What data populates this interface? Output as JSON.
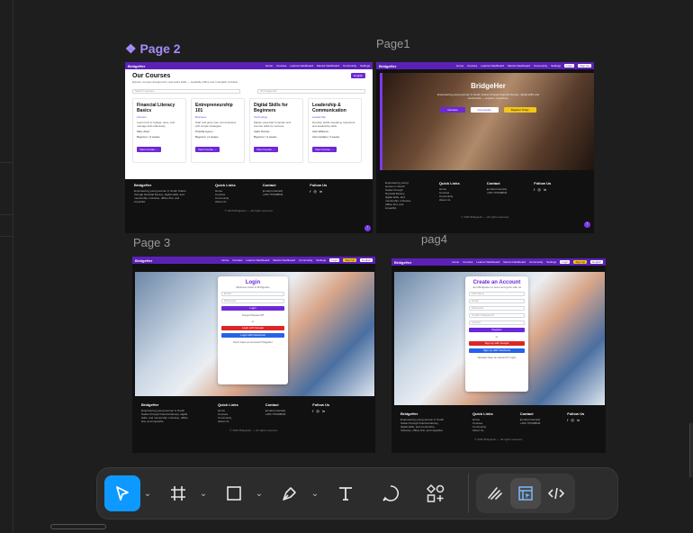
{
  "canvas": {
    "frames": {
      "page2": {
        "label": "Page 2"
      },
      "page1": {
        "label": "Page1"
      },
      "page3": {
        "label": "Page 3"
      },
      "page4": {
        "label": "pag4"
      }
    }
  },
  "site": {
    "brand": "BridgeHer",
    "nav": [
      "Home",
      "Courses",
      "Learner Dashboard",
      "Mentor Dashboard",
      "Community",
      "Settings"
    ],
    "login_btn": "Login",
    "signup_btn": "Sign Up",
    "lang_btn": "English",
    "footer": {
      "brand": "BridgeHer",
      "about": "Empowering young women in South Sudan through financial literacy, digital skills, and mentorship. Inclusive, offline first, and impactful.",
      "quick_links_title": "Quick Links",
      "quick_links": [
        "Home",
        "Courses",
        "Community",
        "About Us"
      ],
      "contact_title": "Contact",
      "email": "[email protected]",
      "phone": "+250 767938840",
      "follow_title": "Follow Us",
      "copyright": "© 2025 BridgeHer — All rights reserved."
    }
  },
  "page2": {
    "title": "Our Courses",
    "subtitle": "Explore courses designed for real-world skills — available offline and in English & Arabic.",
    "search_placeholder": "Search courses...",
    "filter": "All Categories",
    "courses": [
      {
        "title": "Financial Literacy Basics",
        "category": "Finance",
        "desc": "Learn how to budget, save, and manage debt effectively.",
        "author": "Mary Aluel",
        "meta": "Beginner | 3 weeks",
        "cta": "View Course →"
      },
      {
        "title": "Entrepreneurship 101",
        "category": "Business",
        "desc": "Start and grow your own business with simple strategies.",
        "author": "Priscilla Ayeen",
        "meta": "Beginner | 4 weeks",
        "cta": "View Course →"
      },
      {
        "title": "Digital Skills for Beginners",
        "category": "Technology",
        "desc": "Master essential computer and internet skills for success.",
        "author": "Adeh Dorcas",
        "meta": "Beginner | 3 weeks",
        "cta": "View Course →"
      },
      {
        "title": "Leadership & Communication",
        "category": "Leadership",
        "desc": "Develop public speaking, teamwork and leadership skills.",
        "author": "Aitel Williams",
        "meta": "Intermediate | 3 weeks",
        "cta": "View Course →"
      }
    ]
  },
  "page1": {
    "hero_title": "BridgeHer",
    "hero_sub": "Empowering young women in South Sudan through financial literacy, digital skills and mentorship — anytime, anywhere.",
    "btn_courses": "Courses",
    "btn_community": "Community",
    "btn_register": "Register Today"
  },
  "page3": {
    "title": "Login",
    "subtitle": "Welcome back to BridgeHer",
    "email_placeholder": "Email",
    "password_placeholder": "Password",
    "login_btn": "Login",
    "forgot": "Forgot Password?",
    "or": "or",
    "google_btn": "Login with Google",
    "facebook_btn": "Login with Facebook",
    "no_account": "Don't have an account? Register"
  },
  "page4": {
    "title": "Create an Account",
    "subtitle": "Join BridgeHer to learn and grow with us",
    "fields": [
      "Full Name",
      "Email",
      "Password",
      "Confirm Password"
    ],
    "role": "Learner",
    "register_btn": "Register",
    "or": "or",
    "google_btn": "Sign up with Google",
    "facebook_btn": "Sign up with Facebook",
    "have_account": "Already have an account? Login"
  },
  "toolbar": {
    "tools": [
      "move-tool",
      "frame-tool",
      "shape-tool",
      "pen-tool",
      "text-tool",
      "comment-tool",
      "actions-tool"
    ],
    "modes": [
      "draw-mode",
      "design-mode",
      "dev-mode"
    ]
  }
}
